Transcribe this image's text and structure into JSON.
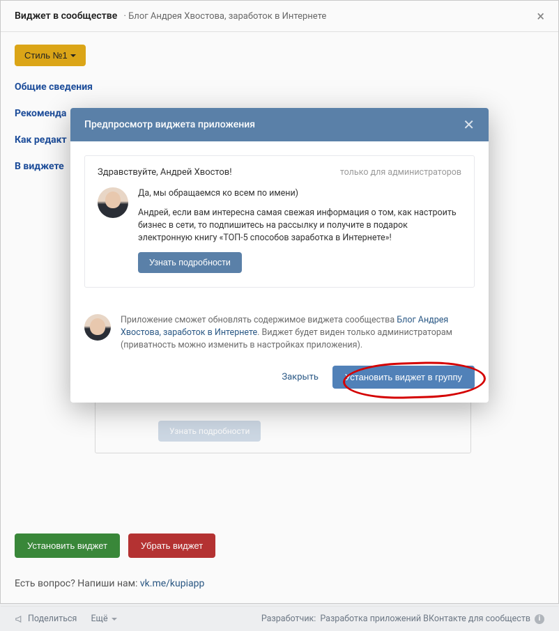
{
  "header": {
    "title": "Виджет в сообществе",
    "subtitle": "· Блог Андрея Хвостова, заработок в Интернете"
  },
  "style_button": "Стиль №1",
  "nav": [
    "Общие сведения",
    "Рекоменда",
    "Как редакт",
    "В виджете"
  ],
  "bg_widget_btn": "Узнать подробности",
  "actions": {
    "install": "Установить виджет",
    "remove": "Убрать виджет"
  },
  "question": {
    "text": "Есть вопрос? Напиши нам: ",
    "link": "vk.me/kupiapp"
  },
  "footer": {
    "share": "Поделиться",
    "more": "Ещё",
    "dev_label": "Разработчик: ",
    "dev_link": "Разработка приложений ВКонтакте для сообществ"
  },
  "modal": {
    "title": "Предпросмотр виджета приложения",
    "greeting": "Здравствуйте, Андрей Хвостов!",
    "admins_only": "только для администраторов",
    "line1": "Да, мы обращаемся ко всем по имени)",
    "line2": "Андрей, если вам интересна самая свежая информация о том, как настроить бизнес в сети, то подпишитесь на рассылку и получите в подарок электронную книгу «ТОП-5 способов заработка в Интернете»!",
    "details_btn": "Узнать подробности",
    "note_prefix": "Приложение сможет обновлять содержимое виджета сообщества ",
    "note_link": "Блог Андрея Хвостова, заработок в Интернете",
    "note_suffix": ". Виджет будет виден только администраторам (приватность можно изменить в настройках приложения).",
    "close": "Закрыть",
    "install": "Установить виджет в группу"
  }
}
